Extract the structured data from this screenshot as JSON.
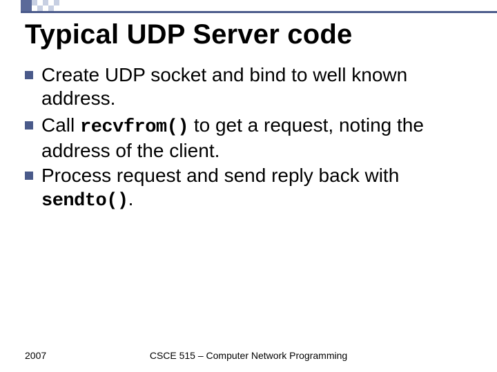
{
  "title": "Typical UDP Server code",
  "bullets": [
    {
      "pre": "Create UDP socket and bind to well known address.",
      "code": "",
      "post": ""
    },
    {
      "pre": "Call ",
      "code": "recvfrom()",
      "post": " to get a request, noting the address of the client."
    },
    {
      "pre": "Process request and send reply back with ",
      "code": "sendto()",
      "post": "."
    }
  ],
  "footer": {
    "year": "2007",
    "course": "CSCE 515 – Computer Network Programming"
  }
}
